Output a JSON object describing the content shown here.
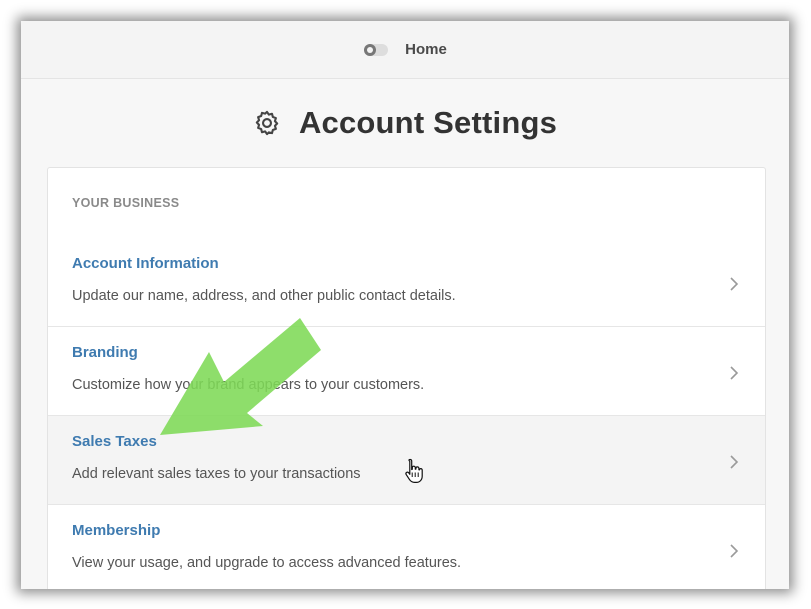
{
  "header": {
    "home_label": "Home",
    "home_icon": "toggle-icon"
  },
  "page": {
    "title": "Account Settings",
    "title_icon": "gear-icon"
  },
  "settings": {
    "section_label": "YOUR BUSINESS",
    "items": [
      {
        "title": "Account Information",
        "description": "Update our name, address, and other public contact details."
      },
      {
        "title": "Branding",
        "description": "Customize how your brand appears to your customers."
      },
      {
        "title": "Sales Taxes",
        "description": "Add relevant sales taxes to your transactions"
      },
      {
        "title": "Membership",
        "description": "View your usage, and upgrade to access advanced features."
      }
    ]
  },
  "annotation": {
    "arrow_icon": "green-arrow-icon",
    "arrow_color": "#7ed957",
    "cursor_icon": "hand-pointer-icon"
  },
  "colors": {
    "link": "#3f7bb0",
    "hover_row": "#f4f4f4",
    "text": "#555555"
  }
}
